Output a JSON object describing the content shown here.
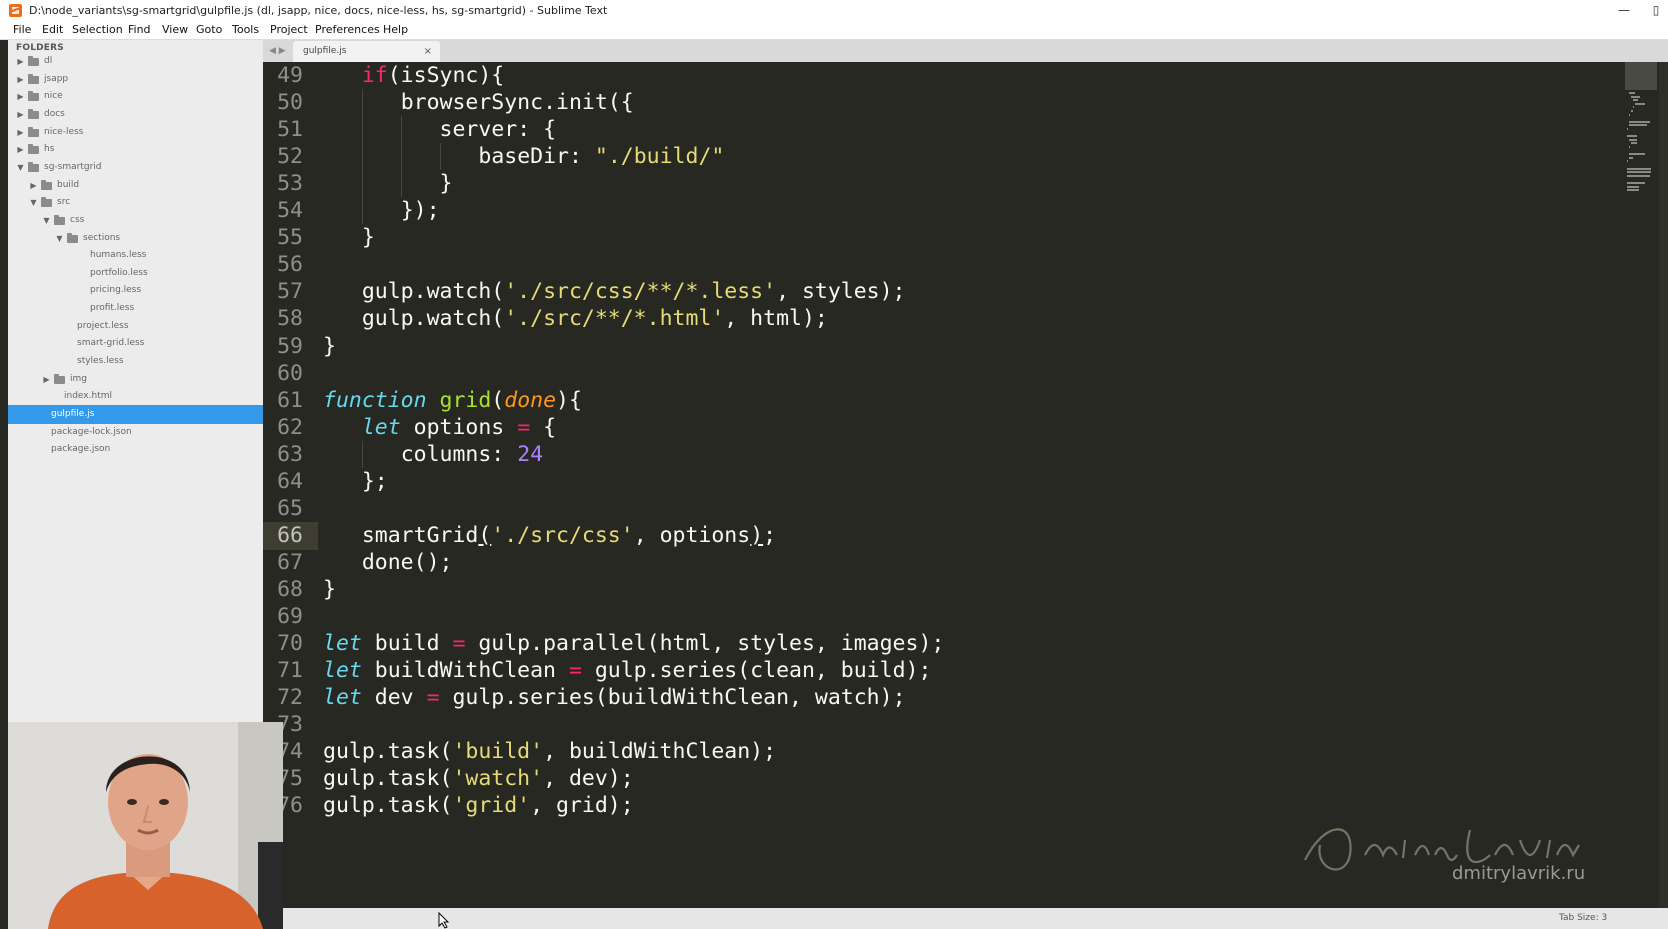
{
  "window": {
    "title": "D:\\node_variants\\sg-smartgrid\\gulpfile.js (dl, jsapp, nice, docs, nice-less, hs, sg-smartgrid) - Sublime Text",
    "controls": [
      "minimize-icon",
      "close-icon"
    ]
  },
  "menu": [
    "File",
    "Edit",
    "Selection",
    "Find",
    "View",
    "Goto",
    "Tools",
    "Project",
    "Preferences",
    "Help"
  ],
  "sidebar": {
    "header": "FOLDERS",
    "items": [
      {
        "label": "dl",
        "depth": 0,
        "type": "folder",
        "state": "collapsed"
      },
      {
        "label": "jsapp",
        "depth": 0,
        "type": "folder",
        "state": "collapsed"
      },
      {
        "label": "nice",
        "depth": 0,
        "type": "folder",
        "state": "collapsed"
      },
      {
        "label": "docs",
        "depth": 0,
        "type": "folder",
        "state": "collapsed"
      },
      {
        "label": "nice-less",
        "depth": 0,
        "type": "folder",
        "state": "collapsed"
      },
      {
        "label": "hs",
        "depth": 0,
        "type": "folder",
        "state": "collapsed"
      },
      {
        "label": "sg-smartgrid",
        "depth": 0,
        "type": "folder",
        "state": "expanded"
      },
      {
        "label": "build",
        "depth": 1,
        "type": "folder",
        "state": "collapsed"
      },
      {
        "label": "src",
        "depth": 1,
        "type": "folder",
        "state": "expanded"
      },
      {
        "label": "css",
        "depth": 2,
        "type": "folder",
        "state": "expanded"
      },
      {
        "label": "sections",
        "depth": 3,
        "type": "folder",
        "state": "expanded"
      },
      {
        "label": "humans.less",
        "depth": 4,
        "type": "file"
      },
      {
        "label": "portfolio.less",
        "depth": 4,
        "type": "file"
      },
      {
        "label": "pricing.less",
        "depth": 4,
        "type": "file"
      },
      {
        "label": "profit.less",
        "depth": 4,
        "type": "file"
      },
      {
        "label": "project.less",
        "depth": 3,
        "type": "file"
      },
      {
        "label": "smart-grid.less",
        "depth": 3,
        "type": "file"
      },
      {
        "label": "styles.less",
        "depth": 3,
        "type": "file"
      },
      {
        "label": "img",
        "depth": 2,
        "type": "folder",
        "state": "collapsed"
      },
      {
        "label": "index.html",
        "depth": 2,
        "type": "file"
      },
      {
        "label": "gulpfile.js",
        "depth": 1,
        "type": "file",
        "selected": true
      },
      {
        "label": "package-lock.json",
        "depth": 1,
        "type": "file"
      },
      {
        "label": "package.json",
        "depth": 1,
        "type": "file"
      }
    ]
  },
  "tabs": [
    {
      "label": "gulpfile.js",
      "close": "×",
      "active": true
    }
  ],
  "tab_nav": "◀ ▶",
  "editor": {
    "current_line": 66,
    "lines": [
      {
        "n": "49",
        "indent": 1,
        "tokens": [
          [
            "kw",
            "if"
          ],
          [
            "plain",
            "(isSync){"
          ]
        ]
      },
      {
        "n": "50",
        "indent": 2,
        "tokens": [
          [
            "plain",
            "browserSync.init({"
          ]
        ]
      },
      {
        "n": "51",
        "indent": 3,
        "tokens": [
          [
            "plain",
            "server: {"
          ]
        ]
      },
      {
        "n": "52",
        "indent": 4,
        "tokens": [
          [
            "plain",
            "baseDir: "
          ],
          [
            "str",
            "\"./build/\""
          ]
        ]
      },
      {
        "n": "53",
        "indent": 3,
        "tokens": [
          [
            "plain",
            "}"
          ]
        ]
      },
      {
        "n": "54",
        "indent": 2,
        "tokens": [
          [
            "plain",
            "});"
          ]
        ]
      },
      {
        "n": "55",
        "indent": 1,
        "tokens": [
          [
            "plain",
            "}"
          ]
        ]
      },
      {
        "n": "56",
        "indent": 0,
        "tokens": []
      },
      {
        "n": "57",
        "indent": 1,
        "tokens": [
          [
            "plain",
            "gulp.watch("
          ],
          [
            "str",
            "'./src/css/**/*.less'"
          ],
          [
            "plain",
            ", styles);"
          ]
        ]
      },
      {
        "n": "58",
        "indent": 1,
        "tokens": [
          [
            "plain",
            "gulp.watch("
          ],
          [
            "str",
            "'./src/**/*.html'"
          ],
          [
            "plain",
            ", html);"
          ]
        ]
      },
      {
        "n": "59",
        "indent": 0,
        "tokens": [
          [
            "plain",
            "}"
          ]
        ]
      },
      {
        "n": "60",
        "indent": 0,
        "tokens": []
      },
      {
        "n": "61",
        "indent": 0,
        "tokens": [
          [
            "storage",
            "function"
          ],
          [
            "plain",
            " "
          ],
          [
            "fn",
            "grid"
          ],
          [
            "plain",
            "("
          ],
          [
            "param",
            "done"
          ],
          [
            "plain",
            "){"
          ]
        ]
      },
      {
        "n": "62",
        "indent": 1,
        "tokens": [
          [
            "storage",
            "let"
          ],
          [
            "plain",
            " options "
          ],
          [
            "kw",
            "="
          ],
          [
            "plain",
            " {"
          ]
        ]
      },
      {
        "n": "63",
        "indent": 2,
        "tokens": [
          [
            "plain",
            "columns: "
          ],
          [
            "num",
            "24"
          ]
        ]
      },
      {
        "n": "64",
        "indent": 1,
        "tokens": [
          [
            "plain",
            "};"
          ]
        ]
      },
      {
        "n": "65",
        "indent": 0,
        "tokens": []
      },
      {
        "n": "66",
        "indent": 1,
        "tokens": [
          [
            "plain",
            "smartGrid"
          ],
          [
            "ul",
            "("
          ],
          [
            "str",
            "'./src/css'"
          ],
          [
            "plain",
            ", options"
          ],
          [
            "ul",
            ")"
          ],
          [
            "plain",
            ";"
          ]
        ]
      },
      {
        "n": "67",
        "indent": 1,
        "tokens": [
          [
            "plain",
            "done();"
          ]
        ]
      },
      {
        "n": "68",
        "indent": 0,
        "tokens": [
          [
            "plain",
            "}"
          ]
        ]
      },
      {
        "n": "69",
        "indent": 0,
        "tokens": []
      },
      {
        "n": "70",
        "indent": 0,
        "tokens": [
          [
            "storage",
            "let"
          ],
          [
            "plain",
            " build "
          ],
          [
            "kw",
            "="
          ],
          [
            "plain",
            " gulp.parallel(html, styles, images);"
          ]
        ]
      },
      {
        "n": "71",
        "indent": 0,
        "tokens": [
          [
            "storage",
            "let"
          ],
          [
            "plain",
            " buildWithClean "
          ],
          [
            "kw",
            "="
          ],
          [
            "plain",
            " gulp.series(clean, build);"
          ]
        ]
      },
      {
        "n": "72",
        "indent": 0,
        "tokens": [
          [
            "storage",
            "let"
          ],
          [
            "plain",
            " dev "
          ],
          [
            "kw",
            "="
          ],
          [
            "plain",
            " gulp.series(buildWithClean, watch);"
          ]
        ]
      },
      {
        "n": "73",
        "indent": 0,
        "tokens": []
      },
      {
        "n": "74",
        "indent": 0,
        "tokens": [
          [
            "plain",
            "gulp.task("
          ],
          [
            "str",
            "'build'"
          ],
          [
            "plain",
            ", buildWithClean);"
          ]
        ]
      },
      {
        "n": "75",
        "indent": 0,
        "tokens": [
          [
            "plain",
            "gulp.task("
          ],
          [
            "str",
            "'watch'"
          ],
          [
            "plain",
            ", dev);"
          ]
        ]
      },
      {
        "n": "76",
        "indent": 0,
        "tokens": [
          [
            "plain",
            "gulp.task("
          ],
          [
            "str",
            "'grid'"
          ],
          [
            "plain",
            ", grid);"
          ]
        ]
      }
    ]
  },
  "status": {
    "tab_size": "Tab Size: 3"
  },
  "watermark": {
    "signature": "Dmitry Lavrik",
    "url": "dmitrylavrik.ru"
  },
  "colors": {
    "editor_bg": "#272822",
    "keyword": "#f92672",
    "string": "#e6db74",
    "storage": "#66d9ef",
    "function": "#a6e22e",
    "parameter": "#fd971f",
    "number": "#ae81ff",
    "selection": "#3399e8"
  }
}
